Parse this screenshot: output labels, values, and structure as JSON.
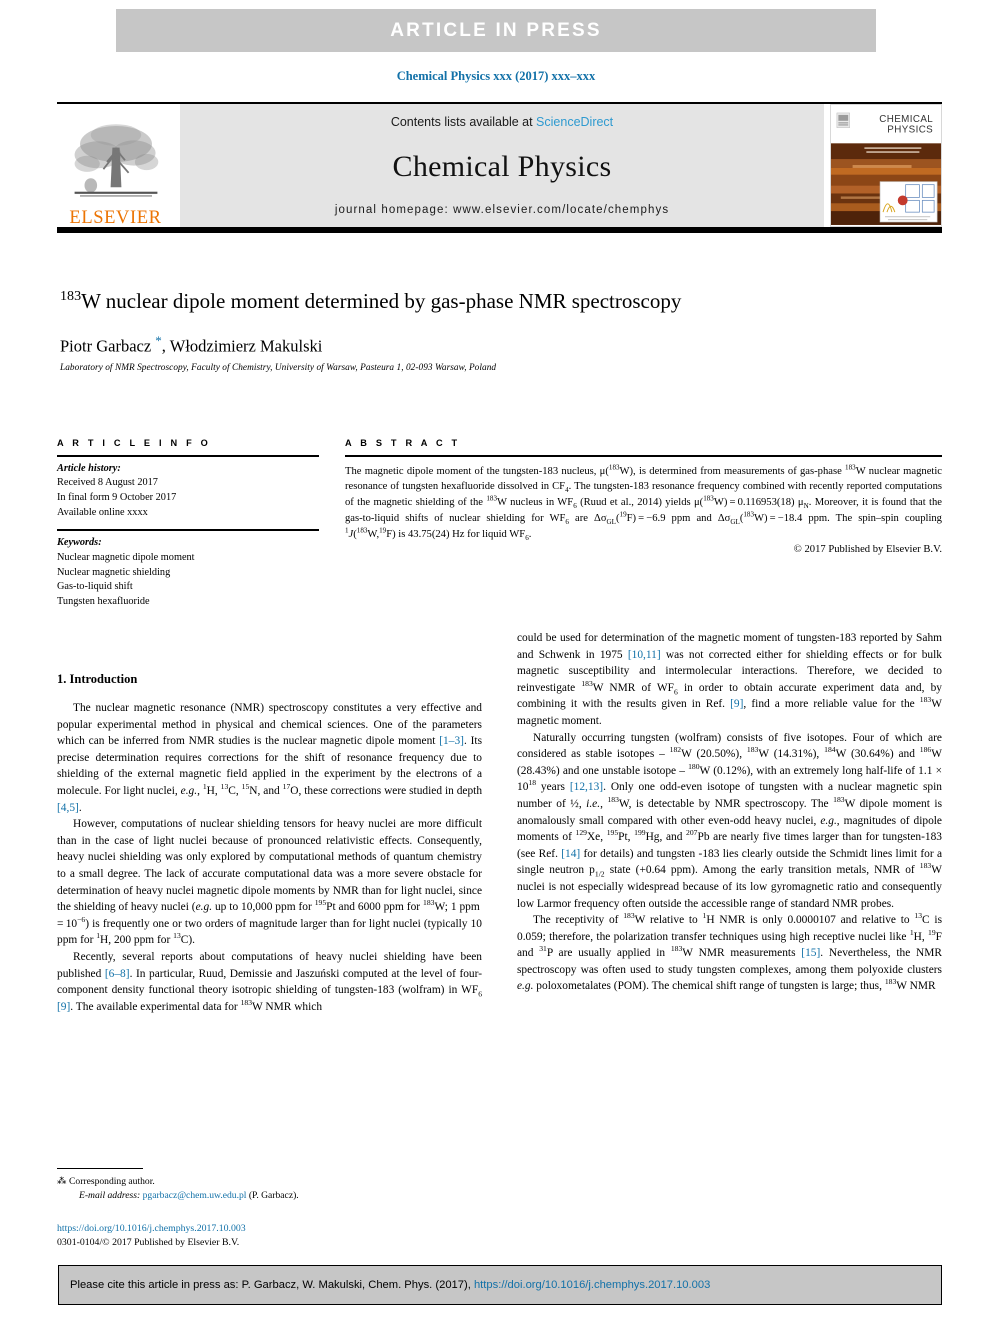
{
  "banner": {
    "text": "ARTICLE  IN  PRESS"
  },
  "running_head": {
    "text": "Chemical Physics xxx (2017) xxx–xxx"
  },
  "masthead": {
    "publisher_name": "ELSEVIER",
    "contents_prefix": "Contents lists available at ",
    "contents_link": "ScienceDirect",
    "journal_name": "Chemical Physics",
    "homepage": "journal homepage: www.elsevier.com/locate/chemphys",
    "cover": {
      "title_line1": "CHEMICAL",
      "title_line2": "PHYSICS"
    }
  },
  "article": {
    "title_html": "<sup>183</sup>W nuclear dipole moment determined by gas-phase NMR spectroscopy",
    "authors_html": "Piotr Garbacz <span class=\"star\">*</span>, Włodzimierz Makulski",
    "affiliation": "Laboratory of NMR Spectroscopy, Faculty of Chemistry, University of Warsaw, Pasteura 1, 02-093 Warsaw, Poland"
  },
  "info": {
    "heading": "A R T I C L E   I N F O",
    "history_label": "Article history:",
    "history": [
      "Received 8 August 2017",
      "In final form 9 October 2017",
      "Available online xxxx"
    ],
    "keywords_label": "Keywords:",
    "keywords": [
      "Nuclear magnetic dipole moment",
      "Nuclear magnetic shielding",
      "Gas-to-liquid shift",
      "Tungsten hexafluoride"
    ]
  },
  "abstract": {
    "heading": "A B S T R A C T",
    "text_html": "The magnetic dipole moment of the tungsten-183 nucleus, μ(<sup>183</sup>W), is determined from measurements of gas-phase <sup>183</sup>W nuclear magnetic resonance of tungsten hexafluoride dissolved in CF<sub>4</sub>. The tungsten-183 resonance frequency combined with recently reported computations of the magnetic shielding of the <sup>183</sup>W nucleus in WF<sub>6</sub> (Ruud et al., 2014) yields μ(<sup>183</sup>W) = 0.116953(18) μ<sub>N</sub>. Moreover, it is found that the gas-to-liquid shifts of nuclear shielding for WF<sub>6</sub> are Δσ<sub>GL</sub>(<sup>19</sup>F) = −6.9 ppm and Δσ<sub>GL</sub>(<sup>183</sup>W) = −18.4 ppm. The spin–spin coupling <sup>1</sup><i>J</i>(<sup>183</sup>W,<sup>19</sup>F) is 43.75(24) Hz for liquid WF<sub>6</sub>.",
    "copyright": "© 2017 Published by Elsevier B.V."
  },
  "body": {
    "section_title": "1. Introduction",
    "left_paragraphs_html": [
      "The nuclear magnetic resonance (NMR) spectroscopy constitutes a very effective and popular experimental method in physical and chemical sciences. One of the parameters which can be inferred from NMR studies is the nuclear magnetic dipole moment <span class=\"lnk\">[1–3]</span>. Its precise determination requires corrections for the shift of resonance frequency due to shielding of the external magnetic field applied in the experiment by the electrons of a molecule. For light nuclei, <i>e.g.</i>, <sup>1</sup>H, <sup>13</sup>C, <sup>15</sup>N, and <sup>17</sup>O, these corrections were studied in depth <span class=\"lnk\">[4,5]</span>.",
      "However, computations of nuclear shielding tensors for heavy nuclei are more difficult than in the case of light nuclei because of pronounced relativistic effects. Consequently, heavy nuclei shielding was only explored by computational methods of quantum chemistry to a small degree. The lack of accurate computational data was a more severe obstacle for determination of heavy nuclei magnetic dipole moments by NMR than for light nuclei, since the shielding of heavy nuclei (<i>e.g.</i> up to 10,000 ppm for <sup>195</sup>Pt and 6000 ppm for <sup>183</sup>W; 1 ppm = 10<sup>−6</sup>) is frequently one or two orders of magnitude larger than for light nuclei (typically 10 ppm for <sup>1</sup>H, 200 ppm for <sup>13</sup>C).",
      "Recently, several reports about computations of heavy nuclei shielding have been published <span class=\"lnk\">[6–8]</span>. In particular, Ruud, Demissie and Jaszuński computed at the level of four-component density functional theory isotropic shielding of tungsten-183 (wolfram) in WF<sub>6</sub> <span class=\"lnk\">[9]</span>. The available experimental data for <sup>183</sup>W NMR which"
    ],
    "right_paragraphs_html": [
      "could be used for determination of the magnetic moment of tungsten-183 reported by Sahm and Schwenk in 1975 <span class=\"lnk\">[10,11]</span> was not corrected either for shielding effects or for bulk magnetic susceptibility and intermolecular interactions. Therefore, we decided to reinvestigate <sup>183</sup>W NMR of WF<sub>6</sub> in order to obtain accurate experiment data and, by combining it with the results given in Ref. <span class=\"lnk\">[9]</span>, find a more reliable value for the <sup>183</sup>W magnetic moment.",
      "Naturally occurring tungsten (wolfram) consists of five isotopes. Four of which are considered as stable isotopes – <sup>182</sup>W (20.50%), <sup>183</sup>W (14.31%), <sup>184</sup>W (30.64%) and <sup>186</sup>W (28.43%) and one unstable isotope – <sup>180</sup>W (0.12%), with an extremely long half-life of 1.1 × 10<sup>18</sup> years <span class=\"lnk\">[12,13]</span>. Only one odd-even isotope of tungsten with a nuclear magnetic spin number of ½, <i>i.e.</i>, <sup>183</sup>W, is detectable by NMR spectroscopy. The <sup>183</sup>W dipole moment is anomalously small compared with other even-odd heavy nuclei, <i>e.g.</i>, magnitudes of dipole moments of <sup>129</sup>Xe, <sup>195</sup>Pt, <sup>199</sup>Hg, and <sup>207</sup>Pb are nearly five times larger than for tungsten-183 (see Ref. <span class=\"lnk\">[14]</span> for details) and tungsten -183 lies clearly outside the Schmidt lines limit for a single neutron p<sub>1/2</sub> state (+0.64 ppm). Among the early transition metals, NMR of <sup>183</sup>W nuclei is not especially widespread because of its low gyromagnetic ratio and consequently low Larmor frequency often outside the accessible range of standard NMR probes.",
      "The receptivity of <sup>183</sup>W relative to <sup>1</sup>H NMR is only 0.0000107 and relative to <sup>13</sup>C is 0.059; therefore, the polarization transfer techniques using high receptive nuclei like <sup>1</sup>H, <sup>19</sup>F and <sup>31</sup>P are usually applied in <sup>183</sup>W NMR measurements <span class=\"lnk\">[15]</span>. Nevertheless, the NMR spectroscopy was often used to study tungsten complexes, among them polyoxide clusters <i>e.g.</i> poloxometalates (POM). The chemical shift range of tungsten is large; thus, <sup>183</sup>W NMR"
    ]
  },
  "footnote": {
    "corresponding": "⁂ Corresponding author.",
    "email_label": "E-mail address:",
    "email": "pgarbacz@chem.uw.edu.pl",
    "email_suffix": "(P. Garbacz).",
    "doi": "https://doi.org/10.1016/j.chemphys.2017.10.003",
    "issn_line": "0301-0104/© 2017 Published by Elsevier B.V."
  },
  "citation_footer": {
    "prefix": "Please cite this article in press as: P. Garbacz, W. Makulski, Chem. Phys. (2017), ",
    "link": "https://doi.org/10.1016/j.chemphys.2017.10.003"
  },
  "colors": {
    "link": "#1271a8",
    "sciencedirect": "#2e9ad0",
    "elsevier_orange": "#ec7404",
    "band_gray": "#c6c6c6",
    "masthead_gray": "#e4e4e4"
  }
}
